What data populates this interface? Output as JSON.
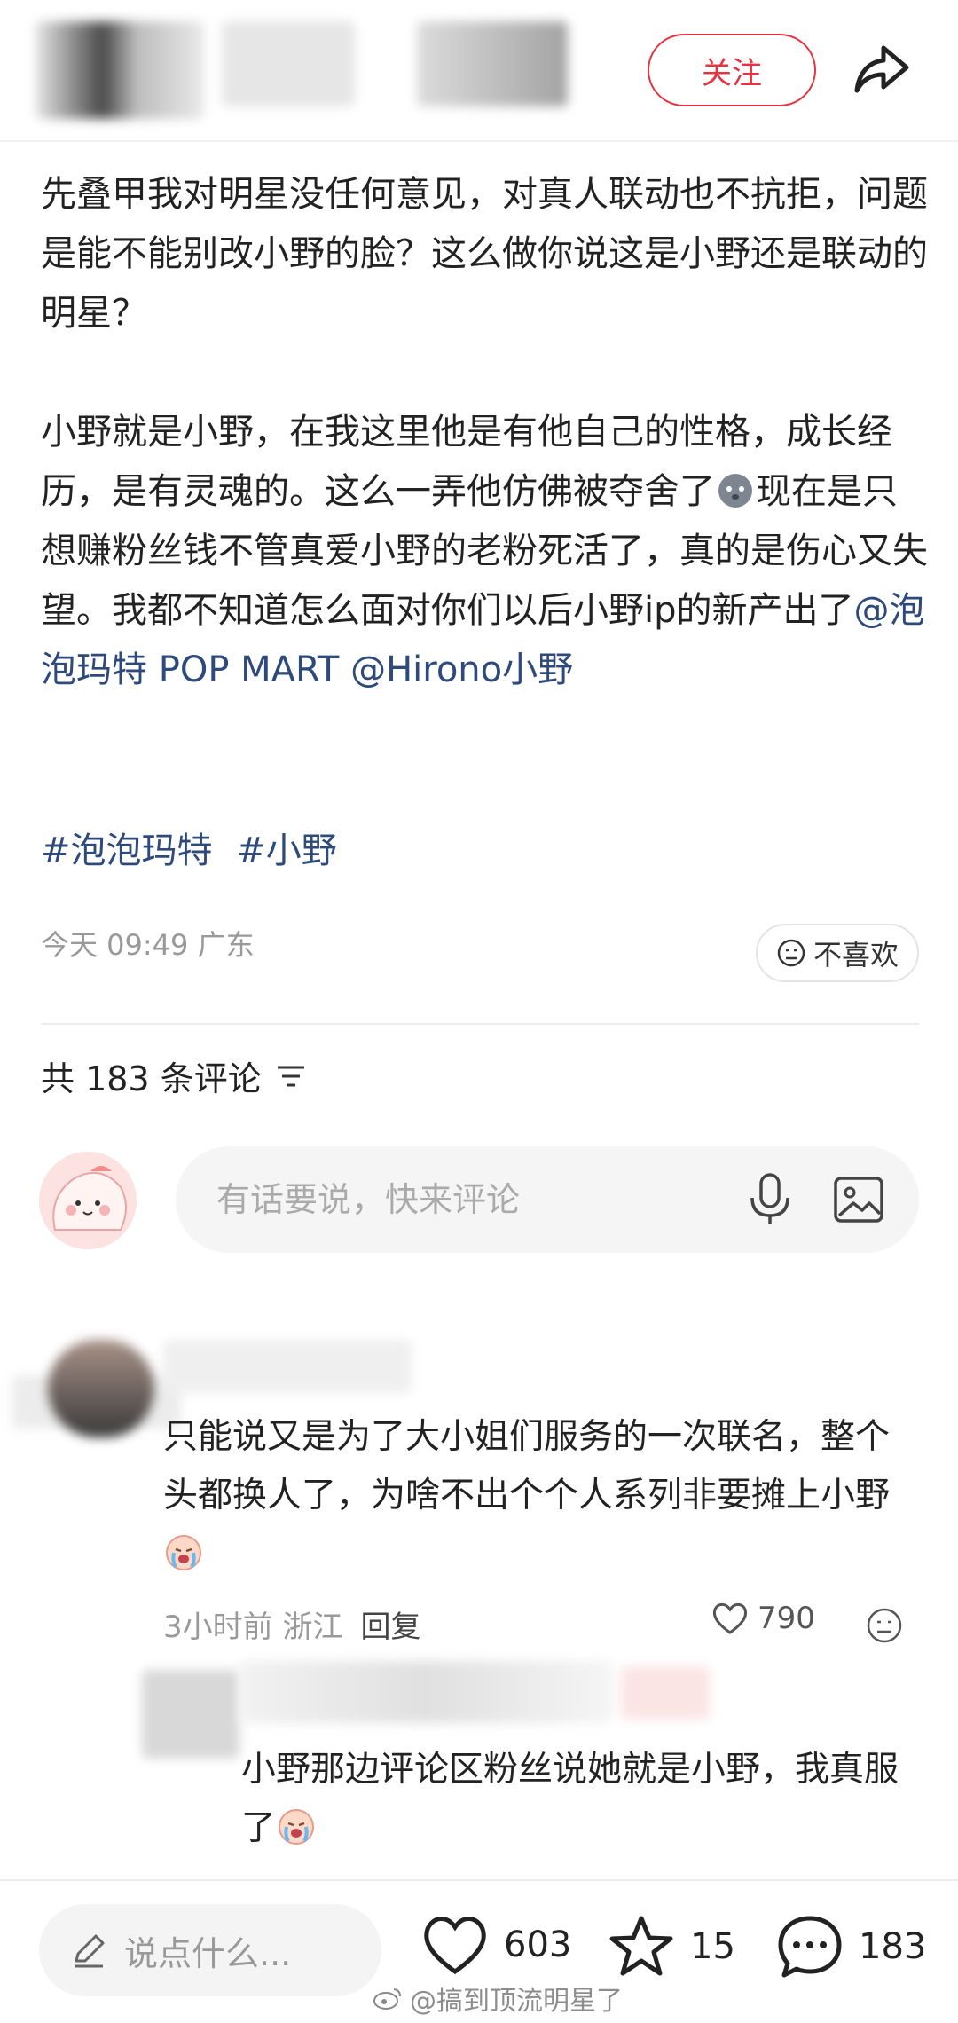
{
  "header": {
    "follow_label": "关注"
  },
  "post": {
    "paragraph1": "先叠甲我对明星没任何意见，对真人联动也不抗拒，问题是能不能别改小野的脸？这么做你说这是小野还是联动的明星？",
    "paragraph2_before": "小野就是小野，在我这里他是有他自己的性格，成长经历，是有灵魂的。这么一弄他仿佛被夺舍了",
    "paragraph2_after": "现在是只想赚粉丝钱不管真爱小野的老粉死活了，真的是伤心又失望。我都不知道怎么面对你们以后小野ip的新产出了",
    "mention1": "@泡泡玛特 POP MART",
    "mention2": "@Hirono小野",
    "tags": [
      "#泡泡玛特",
      "#小野"
    ],
    "meta": "今天 09:49 广东",
    "dislike_label": "不喜欢"
  },
  "comments_section": {
    "count_label": "共 183 条评论",
    "input_placeholder": "有话要说，快来评论"
  },
  "comment": {
    "text": "只能说又是为了大小姐们服务的一次联名，整个头都换人了，为啥不出个个人系列非要摊上小野",
    "time_location": "3小时前 浙江",
    "reply_label": "回复",
    "likes": "790"
  },
  "reply": {
    "text": "小野那边评论区粉丝说她就是小野，我真服了"
  },
  "bottom_bar": {
    "say_placeholder": "说点什么...",
    "likes": "603",
    "stars": "15",
    "comments": "183"
  },
  "watermark": "@搞到顶流明星了",
  "colors": {
    "accent_red": "#e8323f",
    "link_blue": "#2e4a7c"
  }
}
